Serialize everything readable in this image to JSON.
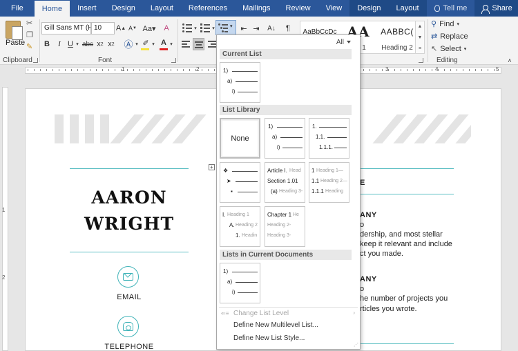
{
  "tabs": {
    "file": "File",
    "home": "Home",
    "insert": "Insert",
    "design": "Design",
    "layout": "Layout",
    "references": "References",
    "mailings": "Mailings",
    "review": "Review",
    "view": "View",
    "ctx_design": "Design",
    "ctx_layout": "Layout",
    "tell_me": "Tell me",
    "share": "Share"
  },
  "clipboard": {
    "paste": "Paste",
    "label": "Clipboard"
  },
  "font": {
    "family": "Gill Sans MT (H",
    "size": "10",
    "label": "Font",
    "font_color": "#e02020",
    "highlight_color": "#f7e23a"
  },
  "paragraph": {
    "label": "Paragraph"
  },
  "styles": {
    "items": [
      {
        "sample": "AaBbCcDc",
        "name": ""
      },
      {
        "sample": "AA",
        "name": "ing 1"
      },
      {
        "sample": "AABBC(",
        "name": "Heading 2"
      }
    ],
    "label": "Styles"
  },
  "editing": {
    "find": "Find",
    "replace": "Replace",
    "select": "Select",
    "label": "Editing"
  },
  "ruler_numbers": [
    "1",
    "2",
    "3",
    "4",
    "5"
  ],
  "vruler_numbers": [
    "1",
    "2"
  ],
  "document": {
    "name_line1": "AARON",
    "name_line2": "WRIGHT",
    "email": "EMAIL",
    "telephone": "TELEPHONE",
    "right": {
      "e": "E",
      "any1": "ANY",
      "o1": "o",
      "p1l1": "dership, and most stellar",
      "p1l2": "keep it relevant and include",
      "p1l3": "ct you made.",
      "any2": "ANY",
      "o2": "o",
      "p2l1": "he number of projects you",
      "p2l2": "rticles you wrote."
    }
  },
  "dropdown": {
    "filter": "All",
    "current_list": "Current List",
    "list_library": "List Library",
    "lists_in_docs": "Lists in Current Documents",
    "none": "None",
    "numerals": {
      "n1": "1)",
      "a": "a)",
      "i": "i)"
    },
    "tile3": {
      "l1": "1.",
      "l2": "1.1.",
      "l3": "1.1.1."
    },
    "tile5": {
      "l1": "Article I.",
      "l1b": "Head",
      "l2": "Section 1.01",
      "l3": "(a)",
      "l3b": "Heading 3-"
    },
    "tile6": {
      "l1": "1",
      "l1b": "Heading 1—",
      "l2": "1.1",
      "l2b": "Heading 2—",
      "l3": "1.1.1",
      "l3b": "Heading"
    },
    "tile7": {
      "l1": "I.",
      "l1b": "Heading 1",
      "l2": "A.",
      "l2b": "Heading 2",
      "l3": "1.",
      "l3b": "Headin"
    },
    "tile8": {
      "l1": "Chapter 1",
      "l1b": "He",
      "l2": "Heading 2-",
      "l3": "Heading 3-"
    },
    "change_level": "Change List Level",
    "define_list": "Define New Multilevel List...",
    "define_style": "Define New List Style..."
  }
}
